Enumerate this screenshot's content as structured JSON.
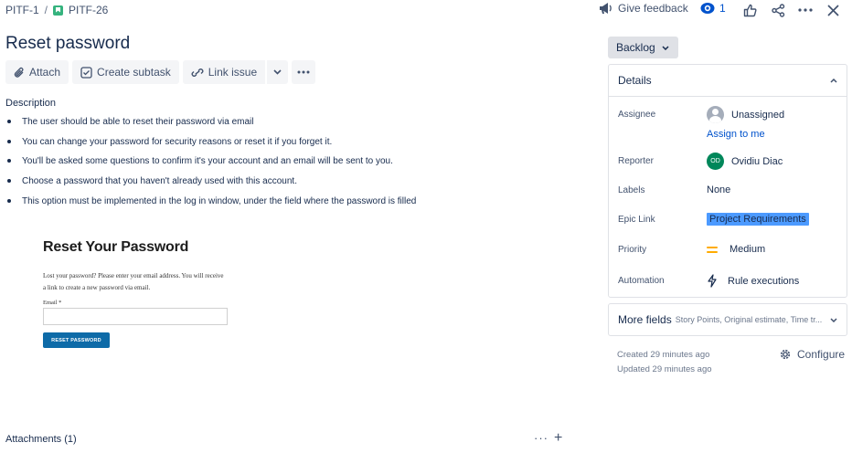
{
  "breadcrumb": {
    "parent": "PITF-1",
    "separator": "/",
    "current": "PITF-26"
  },
  "header": {
    "give_feedback": "Give feedback",
    "watch_count": "1"
  },
  "issue": {
    "title": "Reset password"
  },
  "toolbar": {
    "attach": "Attach",
    "create_subtask": "Create subtask",
    "link_issue": "Link issue"
  },
  "description": {
    "label": "Description",
    "items": [
      "The user should be able to reset their password via email",
      "You can change your password for security reasons or reset it if you forget it.",
      "You'll be asked some questions to confirm it's your account and an email will be sent to you.",
      "Choose a password that you haven't already used with this account.",
      "This option must be implemented in the log in window, under the field where the password is filled"
    ],
    "embedded_image": {
      "heading": "Reset Your Password",
      "text": "Lost your password? Please enter your email address. You will receive a link to create a new password via email.",
      "email_label": "Email *",
      "button": "RESET PASSWORD"
    }
  },
  "attachments": {
    "label": "Attachments (1)"
  },
  "sidebar": {
    "status": "Backlog",
    "details_title": "Details",
    "fields": {
      "assignee_label": "Assignee",
      "assignee_value": "Unassigned",
      "assign_to_me": "Assign to me",
      "reporter_label": "Reporter",
      "reporter_initials": "OD",
      "reporter_value": "Ovidiu Diac",
      "labels_label": "Labels",
      "labels_value": "None",
      "epic_label": "Epic Link",
      "epic_value": "Project Requirements",
      "priority_label": "Priority",
      "priority_value": "Medium",
      "automation_label": "Automation",
      "automation_value": "Rule executions"
    },
    "more_fields_title": "More fields",
    "more_fields_sub": "Story Points, Original estimate, Time tr...",
    "created": "Created 29 minutes ago",
    "updated": "Updated 29 minutes ago",
    "configure": "Configure"
  },
  "colors": {
    "link": "#0052cc",
    "epic_highlight": "#4c9aff",
    "story_icon": "#36b37e",
    "reporter_avatar": "#00875a",
    "priority_medium": "#ffab00"
  }
}
